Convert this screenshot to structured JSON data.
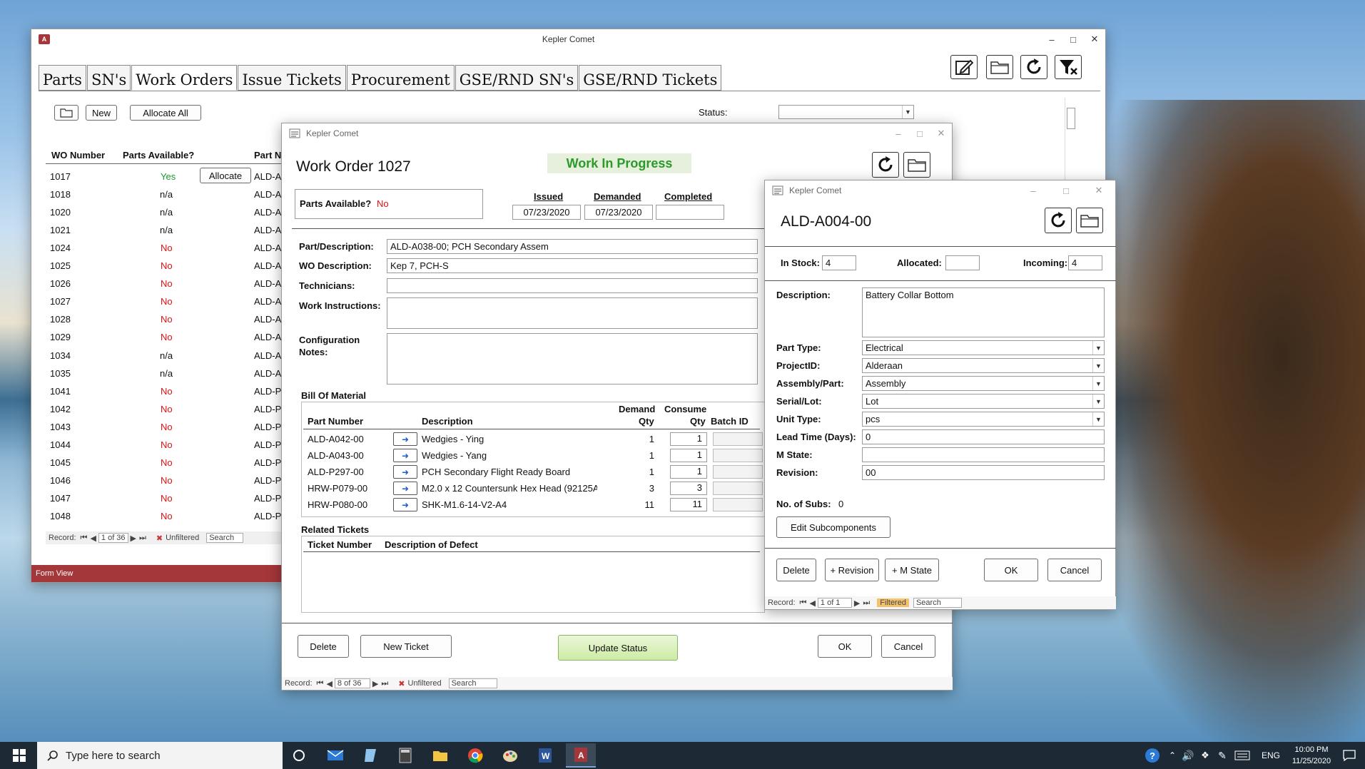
{
  "app_title": "Kepler Comet",
  "main": {
    "tabs": [
      "Parts",
      "SN's",
      "Work Orders",
      "Issue Tickets",
      "Procurement",
      "GSE/RND SN's",
      "GSE/RND Tickets"
    ],
    "new_label": "New",
    "allocate_all_label": "Allocate All",
    "status_label": "Status:",
    "columns": [
      "WO Number",
      "Parts Available?",
      "Part N"
    ],
    "allocate_label": "Allocate",
    "rows": [
      {
        "wo": "1017",
        "avail": "Yes",
        "part": "ALD-A"
      },
      {
        "wo": "1018",
        "avail": "n/a",
        "part": "ALD-A"
      },
      {
        "wo": "1020",
        "avail": "n/a",
        "part": "ALD-A"
      },
      {
        "wo": "1021",
        "avail": "n/a",
        "part": "ALD-A"
      },
      {
        "wo": "1024",
        "avail": "No",
        "part": "ALD-A"
      },
      {
        "wo": "1025",
        "avail": "No",
        "part": "ALD-A"
      },
      {
        "wo": "1026",
        "avail": "No",
        "part": "ALD-A"
      },
      {
        "wo": "1027",
        "avail": "No",
        "part": "ALD-A"
      },
      {
        "wo": "1028",
        "avail": "No",
        "part": "ALD-A"
      },
      {
        "wo": "1029",
        "avail": "No",
        "part": "ALD-A"
      },
      {
        "wo": "1034",
        "avail": "n/a",
        "part": "ALD-A"
      },
      {
        "wo": "1035",
        "avail": "n/a",
        "part": "ALD-A"
      },
      {
        "wo": "1041",
        "avail": "No",
        "part": "ALD-P"
      },
      {
        "wo": "1042",
        "avail": "No",
        "part": "ALD-P"
      },
      {
        "wo": "1043",
        "avail": "No",
        "part": "ALD-P"
      },
      {
        "wo": "1044",
        "avail": "No",
        "part": "ALD-P"
      },
      {
        "wo": "1045",
        "avail": "No",
        "part": "ALD-P"
      },
      {
        "wo": "1046",
        "avail": "No",
        "part": "ALD-P"
      },
      {
        "wo": "1047",
        "avail": "No",
        "part": "ALD-P"
      },
      {
        "wo": "1048",
        "avail": "No",
        "part": "ALD-P"
      }
    ],
    "nav": {
      "record_label": "Record:",
      "position": "1 of 36",
      "filter": "Unfiltered",
      "search": "Search"
    },
    "status_bar": "Form View"
  },
  "work_order": {
    "window_title": "Kepler Comet",
    "title": "Work Order 1027",
    "status": "Work In Progress",
    "parts_available_label": "Parts Available?",
    "parts_available_value": "No",
    "date_headers": [
      "Issued",
      "Demanded",
      "Completed"
    ],
    "issued": "07/23/2020",
    "demanded": "07/23/2020",
    "completed": "",
    "part_desc_label": "Part/Description:",
    "part_desc_value": "ALD-A038-00; PCH Secondary Assem",
    "wo_desc_label": "WO Description:",
    "wo_desc_value": "Kep 7, PCH-S",
    "technicians_label": "Technicians:",
    "work_instructions_label": "Work Instructions:",
    "config_notes_label": "Configuration Notes:",
    "bom_label": "Bill Of Material",
    "bom_headers": {
      "part": "Part Number",
      "desc": "Description",
      "demand1": "Demand",
      "demand2": "Qty",
      "consume1": "Consume",
      "consume2": "Qty",
      "batch": "Batch ID"
    },
    "bom": [
      {
        "part": "ALD-A042-00",
        "desc": "Wedgies - Ying",
        "demand": "1",
        "consume": "1"
      },
      {
        "part": "ALD-A043-00",
        "desc": "Wedgies - Yang",
        "demand": "1",
        "consume": "1"
      },
      {
        "part": "ALD-P297-00",
        "desc": "PCH Secondary Flight Ready Board",
        "demand": "1",
        "consume": "1"
      },
      {
        "part": "HRW-P079-00",
        "desc": "M2.0 x 12 Countersunk Hex Head (92125A",
        "demand": "3",
        "consume": "3"
      },
      {
        "part": "HRW-P080-00",
        "desc": "SHK-M1.6-14-V2-A4",
        "demand": "11",
        "consume": "11"
      }
    ],
    "related_label": "Related Tickets",
    "related_headers": [
      "Ticket Number",
      "Description of Defect"
    ],
    "delete_label": "Delete",
    "new_ticket_label": "New Ticket",
    "update_status_label": "Update Status",
    "ok_label": "OK",
    "cancel_label": "Cancel",
    "nav": {
      "record_label": "Record:",
      "position": "8 of 36",
      "filter": "Unfiltered",
      "search": "Search"
    }
  },
  "part": {
    "window_title": "Kepler Comet",
    "title": "ALD-A004-00",
    "in_stock_label": "In Stock:",
    "in_stock": "4",
    "allocated_label": "Allocated:",
    "allocated": "",
    "incoming_label": "Incoming:",
    "incoming": "4",
    "description_label": "Description:",
    "description": "Battery Collar Bottom",
    "part_type_label": "Part Type:",
    "part_type": "Electrical",
    "project_label": "ProjectID:",
    "project": "Alderaan",
    "assembly_label": "Assembly/Part:",
    "assembly": "Assembly",
    "serial_label": "Serial/Lot:",
    "serial": "Lot",
    "unit_label": "Unit Type:",
    "unit": "pcs",
    "lead_label": "Lead Time (Days):",
    "lead": "0",
    "mstate_label": "M State:",
    "mstate": "",
    "revision_label": "Revision:",
    "revision": "00",
    "subs_label": "No. of Subs:",
    "subs": "0",
    "edit_subs_label": "Edit Subcomponents",
    "delete_label": "Delete",
    "revision_btn": "+ Revision",
    "mstate_btn": "+ M State",
    "ok_label": "OK",
    "cancel_label": "Cancel",
    "nav": {
      "record_label": "Record:",
      "position": "1 of 1",
      "filter": "Filtered",
      "search": "Search"
    }
  },
  "taskbar": {
    "search_placeholder": "Type here to search",
    "lang": "ENG",
    "time": "10:00 PM",
    "date": "11/25/2020"
  },
  "colors": {
    "access_red": "#a4373a",
    "status_green": "#1a9a2a",
    "alert_red": "#d11"
  }
}
